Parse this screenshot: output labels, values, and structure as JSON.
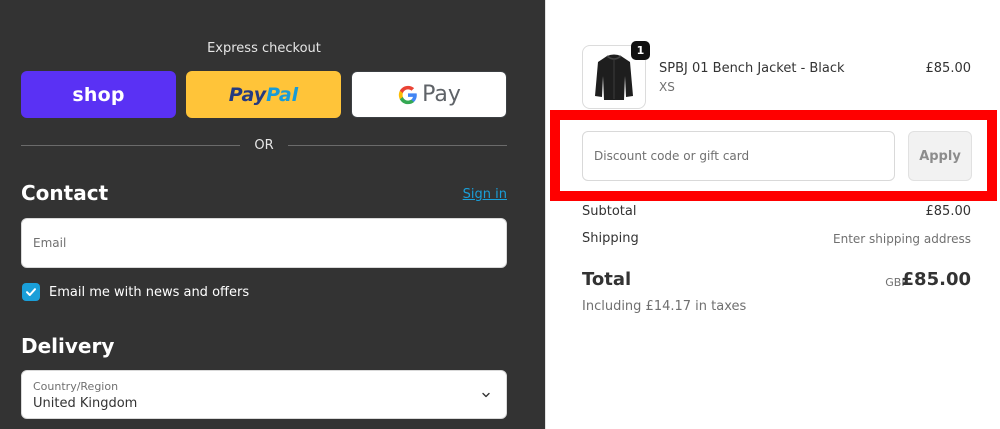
{
  "express": {
    "title": "Express checkout",
    "shop_label": "shop",
    "paypal_part1": "Pay",
    "paypal_part2": "Pal",
    "gpay_g": "G",
    "gpay_label": "Pay",
    "or_label": "OR"
  },
  "contact": {
    "heading": "Contact",
    "signin_label": "Sign in",
    "email_placeholder": "Email",
    "newsletter_label": "Email me with news and offers",
    "newsletter_checked": true
  },
  "delivery": {
    "heading": "Delivery",
    "country_label": "Country/Region",
    "country_value": "United Kingdom"
  },
  "order": {
    "item": {
      "quantity": "1",
      "name": "SPBJ 01 Bench Jacket - Black",
      "variant": "XS",
      "price": "£85.00"
    },
    "discount_placeholder": "Discount code or gift card",
    "apply_label": "Apply",
    "subtotal_label": "Subtotal",
    "subtotal_value": "£85.00",
    "shipping_label": "Shipping",
    "shipping_value": "Enter shipping address",
    "total_label": "Total",
    "total_currency": "GBP",
    "total_value": "£85.00",
    "taxes_note": "Including £14.17 in taxes"
  },
  "colors": {
    "left_bg": "#333333",
    "shop_purple": "#5a31f4",
    "paypal_yellow": "#ffc439",
    "accent_blue": "#1a9fd9",
    "highlight_red": "#ff0000"
  }
}
